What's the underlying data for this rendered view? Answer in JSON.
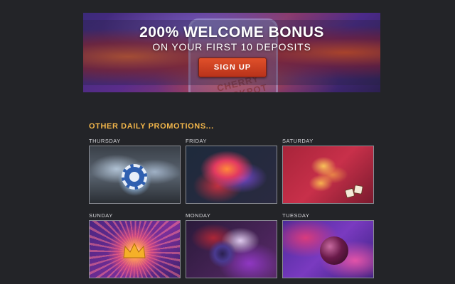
{
  "hero": {
    "title": "200% WELCOME BONUS",
    "subtitle": "ON YOUR FIRST 10 DEPOSITS",
    "signup_label": "SIGN UP",
    "slot_text": "CHERRY JACKPOT"
  },
  "promotions": {
    "heading": "OTHER DAILY PROMOTIONS...",
    "days": [
      {
        "day": "THURSDAY",
        "image": "casino-chip-splash"
      },
      {
        "day": "FRIDAY",
        "image": "flame-cubes"
      },
      {
        "day": "SATURDAY",
        "image": "gold-dollar-dice"
      },
      {
        "day": "SUNDAY",
        "image": "crown-burst"
      },
      {
        "day": "MONDAY",
        "image": "cosmic-splash"
      },
      {
        "day": "TUESDAY",
        "image": "cherry-splash"
      }
    ]
  },
  "colors": {
    "background": "#232428",
    "heading_accent": "#f2b64a",
    "signup_button": "#d2452a"
  }
}
